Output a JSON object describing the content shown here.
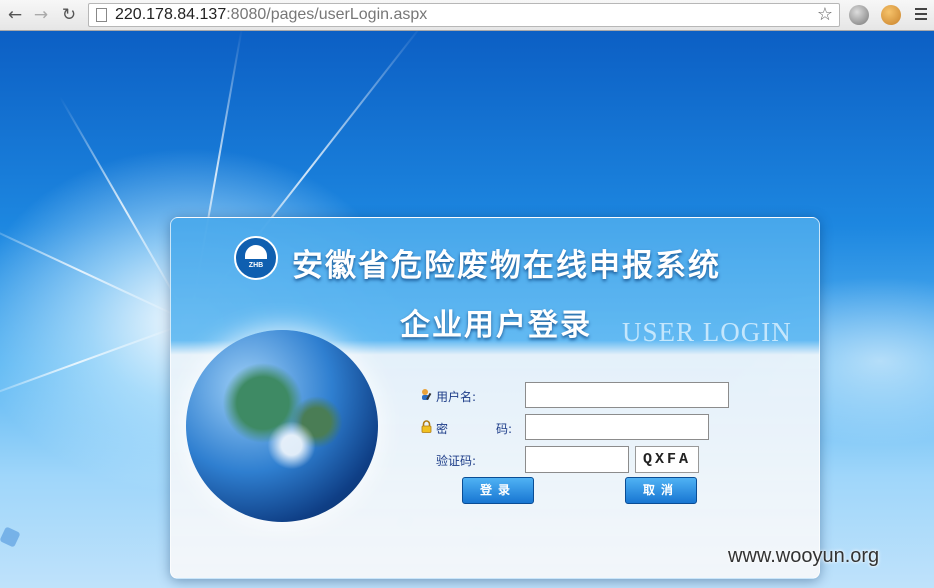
{
  "browser": {
    "url_host": "220.178.84.137",
    "url_rest": ":8080/pages/userLogin.aspx",
    "back_glyph": "←",
    "forward_glyph": "→",
    "reload_glyph": "↻",
    "star_glyph": "☆"
  },
  "header": {
    "system_title": "安徽省危险废物在线申报系统",
    "login_title": "企业用户登录",
    "english_title": "USER LOGIN",
    "emblem_text": "ZHB"
  },
  "form": {
    "username_label": "用户名:",
    "username_value": "",
    "password_label": "密",
    "password_label_2": "码:",
    "password_value": "",
    "captcha_label": "验证码:",
    "captcha_value": "",
    "captcha_image_text": "QXFA"
  },
  "buttons": {
    "login": "登录",
    "cancel": "取消"
  },
  "watermark": "www.wooyun.org",
  "colors": {
    "accent": "#1876d2",
    "label_text": "#1c3c88"
  },
  "icons": {
    "user": "user-edit-icon",
    "password": "lock-icon"
  }
}
